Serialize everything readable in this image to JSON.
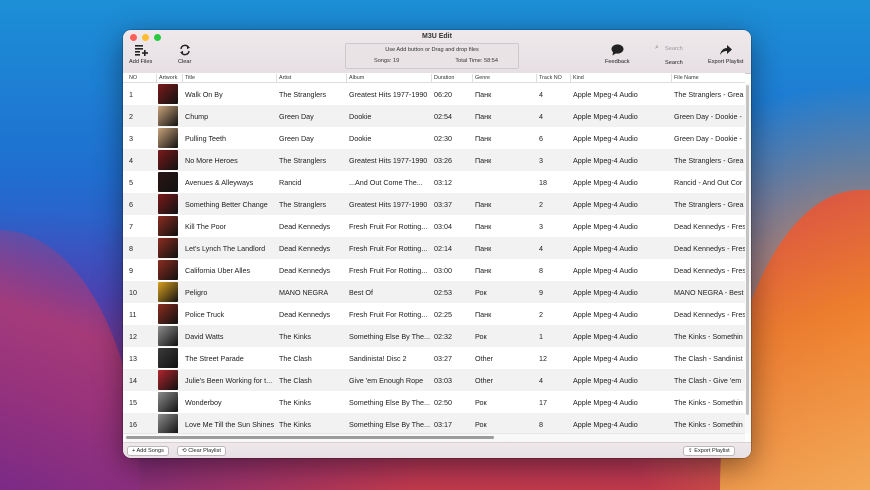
{
  "window": {
    "title": "M3U Edit"
  },
  "toolbar": {
    "add_files": "Add Files",
    "clear": "Clear",
    "feedback": "Feedback",
    "search": "Search",
    "search_placeholder": "Search",
    "export_playlist": "Export Playlist"
  },
  "status": {
    "message": "Use Add button or Drag and drop files",
    "songs": "Songs: 19",
    "total_time": "Total Time: 58:54"
  },
  "columns": [
    "NO",
    "Artwork",
    "Title",
    "Artist",
    "Album",
    "Duration",
    "Genre",
    "Track NO",
    "Kind",
    "File Name"
  ],
  "rows": [
    {
      "no": "1",
      "title": "Walk On By",
      "artist": "The Stranglers",
      "album": "Greatest Hits 1977-1990",
      "duration": "06:20",
      "genre": "Панк",
      "track": "4",
      "kind": "Apple Mpeg-4 Audio",
      "file": "The Stranglers - Grea",
      "art": "#7a1a1a"
    },
    {
      "no": "2",
      "title": "Chump",
      "artist": "Green Day",
      "album": "Dookie",
      "duration": "02:54",
      "genre": "Панк",
      "track": "4",
      "kind": "Apple Mpeg-4 Audio",
      "file": "Green Day - Dookie -",
      "art": "#c9a37a"
    },
    {
      "no": "3",
      "title": "Pulling Teeth",
      "artist": "Green Day",
      "album": "Dookie",
      "duration": "02:30",
      "genre": "Панк",
      "track": "6",
      "kind": "Apple Mpeg-4 Audio",
      "file": "Green Day - Dookie -",
      "art": "#c9a37a"
    },
    {
      "no": "4",
      "title": "No More Heroes",
      "artist": "The Stranglers",
      "album": "Greatest Hits 1977-1990",
      "duration": "03:26",
      "genre": "Панк",
      "track": "3",
      "kind": "Apple Mpeg-4 Audio",
      "file": "The Stranglers - Grea",
      "art": "#7a1a1a"
    },
    {
      "no": "5",
      "title": "Avenues & Alleyways",
      "artist": "Rancid",
      "album": "...And Out Come The...",
      "duration": "03:12",
      "genre": "",
      "track": "18",
      "kind": "Apple Mpeg-4 Audio",
      "file": "Rancid - And Out Cor",
      "art": "#2b1616"
    },
    {
      "no": "6",
      "title": "Something Better Change",
      "artist": "The Stranglers",
      "album": "Greatest Hits 1977-1990",
      "duration": "03:37",
      "genre": "Панк",
      "track": "2",
      "kind": "Apple Mpeg-4 Audio",
      "file": "The Stranglers - Grea",
      "art": "#7a1a1a"
    },
    {
      "no": "7",
      "title": "Kill The Poor",
      "artist": "Dead Kennedys",
      "album": "Fresh Fruit For Rotting...",
      "duration": "03:04",
      "genre": "Панк",
      "track": "3",
      "kind": "Apple Mpeg-4 Audio",
      "file": "Dead Kennedys - Fres",
      "art": "#8a2d1f"
    },
    {
      "no": "8",
      "title": "Let's Lynch The Landlord",
      "artist": "Dead Kennedys",
      "album": "Fresh Fruit For Rotting...",
      "duration": "02:14",
      "genre": "Панк",
      "track": "4",
      "kind": "Apple Mpeg-4 Audio",
      "file": "Dead Kennedys - Fres",
      "art": "#8a2d1f"
    },
    {
      "no": "9",
      "title": "California Uber Alles",
      "artist": "Dead Kennedys",
      "album": "Fresh Fruit For Rotting...",
      "duration": "03:00",
      "genre": "Панк",
      "track": "8",
      "kind": "Apple Mpeg-4 Audio",
      "file": "Dead Kennedys - Fres",
      "art": "#8a2d1f"
    },
    {
      "no": "10",
      "title": "Peligro",
      "artist": "MANO NEGRA",
      "album": "Best Of",
      "duration": "02:53",
      "genre": "Рок",
      "track": "9",
      "kind": "Apple Mpeg-4 Audio",
      "file": "MANO NEGRA - Best",
      "art": "#d9a020"
    },
    {
      "no": "11",
      "title": "Police Truck",
      "artist": "Dead Kennedys",
      "album": "Fresh Fruit For Rotting...",
      "duration": "02:25",
      "genre": "Панк",
      "track": "2",
      "kind": "Apple Mpeg-4 Audio",
      "file": "Dead Kennedys - Fres",
      "art": "#8a2d1f"
    },
    {
      "no": "12",
      "title": "David Watts",
      "artist": "The Kinks",
      "album": "Something Else By The...",
      "duration": "02:32",
      "genre": "Рок",
      "track": "1",
      "kind": "Apple Mpeg-4 Audio",
      "file": "The Kinks - Somethin",
      "art": "#8c8c8c"
    },
    {
      "no": "13",
      "title": "The Street Parade",
      "artist": "The Clash",
      "album": "Sandinista! Disc 2",
      "duration": "03:27",
      "genre": "Other",
      "track": "12",
      "kind": "Apple Mpeg-4 Audio",
      "file": "The Clash - Sandinist",
      "art": "#3a3a3a"
    },
    {
      "no": "14",
      "title": "Julie's Been Working for t...",
      "artist": "The Clash",
      "album": "Give 'em Enough Rope",
      "duration": "03:03",
      "genre": "Other",
      "track": "4",
      "kind": "Apple Mpeg-4 Audio",
      "file": "The Clash - Give 'em",
      "art": "#b0262d"
    },
    {
      "no": "15",
      "title": "Wonderboy",
      "artist": "The Kinks",
      "album": "Something Else By The...",
      "duration": "02:50",
      "genre": "Рок",
      "track": "17",
      "kind": "Apple Mpeg-4 Audio",
      "file": "The Kinks - Somethin",
      "art": "#8c8c8c"
    },
    {
      "no": "16",
      "title": "Love Me Till the Sun Shines",
      "artist": "The Kinks",
      "album": "Something Else By The...",
      "duration": "03:17",
      "genre": "Рок",
      "track": "8",
      "kind": "Apple Mpeg-4 Audio",
      "file": "The Kinks - Somethin",
      "art": "#8c8c8c"
    }
  ],
  "bottom": {
    "add_songs": "+ Add Songs",
    "clear_playlist": "Clear Playlist",
    "export_playlist": "Export Playlist"
  }
}
